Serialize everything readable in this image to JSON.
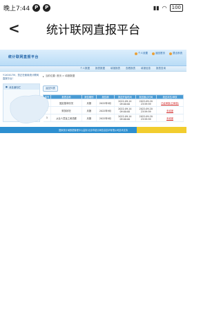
{
  "status_bar": {
    "time": "晚上7:44",
    "notif1": "P",
    "notif2": "P",
    "battery": "100"
  },
  "app_header": {
    "title": "统计联网直报平台"
  },
  "web": {
    "logo_text": "统计联网直报平台",
    "top_links": [
      "个人设置",
      "返回首页",
      "退出系统"
    ],
    "nav_items": [
      "个人数据",
      "报表数据",
      "填报报表",
      "查看报表",
      "填报信息",
      "报表查询"
    ],
    "user_text": "Y1X0017M，您正在使用统计联网直报平台！",
    "left_box_title": "消息通知栏",
    "breadcrumb": "当前位置: 首页 > 填报数据",
    "back_button": "返回列表",
    "table": {
      "headers": [
        "序号",
        "报表名称",
        "报告期别",
        "报告期",
        "报送开始时间",
        "报送截止时间",
        "报送状态/审核"
      ],
      "rows": [
        {
          "no": "1",
          "name": "固定基本情况",
          "period_type": "月报",
          "period": "2022年9月",
          "start": [
            "2022-09-14",
            "09:00:00"
          ],
          "end": [
            "2022-09-20",
            "23:59:59"
          ],
          "status": "已经审核(已审核)"
        },
        {
          "no": "2",
          "name": "财务状况",
          "period_type": "月报",
          "period": "2022年9月",
          "start": [
            "2022-09-14",
            "09:00:00"
          ],
          "end": [
            "2022-09-20",
            "23:59:59"
          ],
          "status": "未填报"
        },
        {
          "no": "3",
          "name": "从业人员及工资总额",
          "period_type": "月报",
          "period": "2022年9月",
          "start": [
            "2022-09-14",
            "09:00:00"
          ],
          "end": [
            "2022-09-20",
            "23:59:59"
          ],
          "status": "未填报"
        }
      ]
    },
    "footer": "国家统计局数据管理中心监制 北京市统计局信息技术有限公司技术支持"
  }
}
